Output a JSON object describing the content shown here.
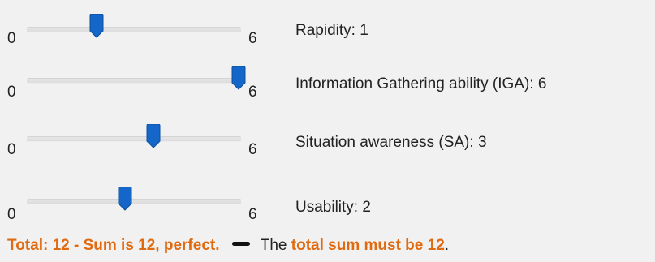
{
  "sliders": [
    {
      "min_label": "0",
      "max_label": "6",
      "label": "Rapidity: 1",
      "value": 1,
      "min": 0,
      "max": 6
    },
    {
      "min_label": "0",
      "max_label": "6",
      "label": "Information Gathering ability (IGA): 6",
      "value": 6,
      "min": 0,
      "max": 6
    },
    {
      "min_label": "0",
      "max_label": "6",
      "label": "Situation awareness (SA): 3",
      "value": 3,
      "min": 0,
      "max": 6
    },
    {
      "min_label": "0",
      "max_label": "6",
      "label": "Usability: 2",
      "value": 2,
      "min": 0,
      "max": 6
    }
  ],
  "footer": {
    "total_text": "Total: 12 - Sum is 12, perfect.",
    "the_text": "The",
    "must_text": "total sum must be 12",
    "period": "."
  },
  "colors": {
    "thumb": "#1466c8",
    "thumb_edge": "#0d4f9e",
    "accent_orange": "#e06a10"
  },
  "icons": {
    "slider_thumb": "slider-thumb-icon",
    "dash": "dash-icon"
  }
}
